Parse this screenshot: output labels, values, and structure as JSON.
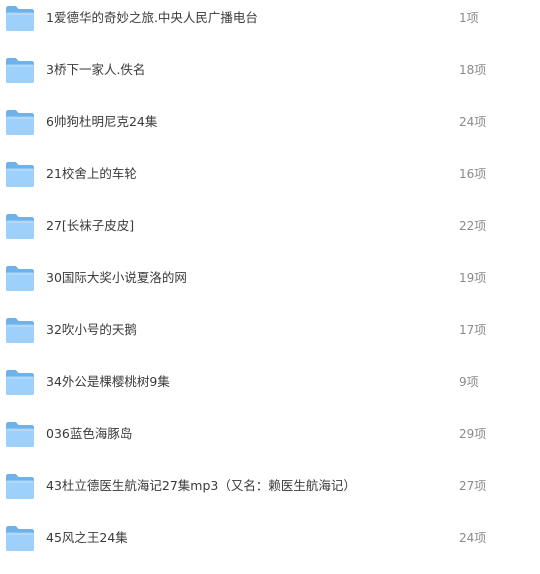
{
  "folders": [
    {
      "icon": "folder-icon",
      "name": "1爱德华的奇妙之旅.中央人民广播电台",
      "count": "1项"
    },
    {
      "icon": "folder-icon",
      "name": "3桥下一家人.佚名",
      "count": "18项"
    },
    {
      "icon": "folder-icon",
      "name": "6帅狗杜明尼克24集",
      "count": "24项"
    },
    {
      "icon": "folder-icon",
      "name": "21校舍上的车轮",
      "count": "16项"
    },
    {
      "icon": "folder-icon",
      "name": "27[长袜子皮皮]",
      "count": "22项"
    },
    {
      "icon": "folder-icon",
      "name": "30国际大奖小说夏洛的网",
      "count": "19项"
    },
    {
      "icon": "folder-icon",
      "name": "32吹小号的天鹅",
      "count": "17项"
    },
    {
      "icon": "folder-icon",
      "name": "34外公是棵樱桃树9集",
      "count": "9项"
    },
    {
      "icon": "folder-icon",
      "name": "036蓝色海豚岛",
      "count": "29项"
    },
    {
      "icon": "folder-icon",
      "name": "43杜立德医生航海记27集mp3（又名：赖医生航海记）",
      "count": "27项"
    },
    {
      "icon": "folder-icon",
      "name": "45风之王24集",
      "count": "24项"
    }
  ],
  "colors": {
    "folder_back": "#6fb2ea",
    "folder_front": "#9dd0fb",
    "name_text": "#3a3a3a",
    "count_text": "#8a8a8a"
  }
}
